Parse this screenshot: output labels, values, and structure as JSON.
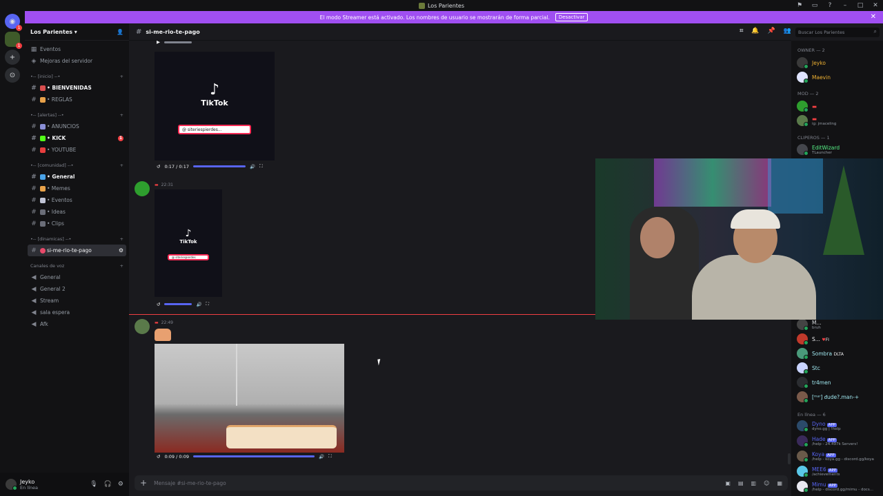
{
  "window": {
    "title": "Los Parientes"
  },
  "banner": {
    "text": "El modo Streamer está activado. Los nombres de usuario se mostrarán de forma parcial.",
    "button": "Desactivar"
  },
  "server": {
    "name": "Los Parientes"
  },
  "sidebar": {
    "top_items": [
      "Eventos",
      "Mejoras del servidor"
    ],
    "categories": [
      {
        "label": "•-- [inicio] --•",
        "channels": [
          {
            "name": "• BIENVENIDAS",
            "bright": true
          },
          {
            "name": "• REGLAS",
            "bright": false
          }
        ]
      },
      {
        "label": "•-- [alertas] --•",
        "channels": [
          {
            "name": "• ANUNCIOS",
            "bright": false
          },
          {
            "name": "• KICK",
            "bright": true,
            "badge": "1"
          },
          {
            "name": "• YOUTUBE",
            "bright": false
          }
        ]
      },
      {
        "label": "•-- [comunidad] --•",
        "channels": [
          {
            "name": "• General",
            "bright": true
          },
          {
            "name": "• Memes",
            "bright": false
          },
          {
            "name": "• Eventos",
            "bright": false
          },
          {
            "name": "• Ideas",
            "bright": false
          },
          {
            "name": "• Clips",
            "bright": false
          }
        ]
      },
      {
        "label": "•-- [dinamicas] --•",
        "channels": [
          {
            "name": "si-me-rio-te-pago",
            "active": true
          }
        ]
      }
    ],
    "voice_label": "Canales de voz",
    "voice_channels": [
      "General",
      "General 2",
      "Stream",
      "sala espera",
      "Afk"
    ]
  },
  "user_panel": {
    "name": "Jeyko",
    "status": "En línea"
  },
  "channel": {
    "name": "si-me-rio-te-pago",
    "search_placeholder": "Buscar Los Parientes",
    "input_placeholder": "Mensaje #si-me-rio-te-pago"
  },
  "messages": {
    "video1": {
      "brand": "TikTok",
      "search": "@ siteriespierdes...",
      "time": "0:17 / 0:17"
    },
    "msg2": {
      "time": "22:31",
      "brand": "TikTok",
      "search": "@ siteriespierdes"
    },
    "msg3": {
      "time": "22:49",
      "video_time": "0:09 / 0:09"
    }
  },
  "members": {
    "owner_label": "OWNER — 2",
    "owners": [
      {
        "name": "Jeyko",
        "color": "#f0b232"
      },
      {
        "name": "Maevin",
        "color": "#f0b232"
      }
    ],
    "mod_label": "MOD — 2",
    "mods": [
      {
        "name": "",
        "sub": ""
      },
      {
        "name": "",
        "sub": "ig: jmaceling"
      }
    ],
    "clipper_label": "CLIPEROS — 1",
    "clippers": [
      {
        "name": "EditWizard",
        "sub": "TLauncher"
      }
    ],
    "lower": [
      {
        "name": "M...",
        "sub": "bruh",
        "color": "#dbdee1"
      },
      {
        "name": "S...",
        "tag": "FI",
        "color": "#f2f3f5"
      },
      {
        "name": "Sombra",
        "tag": "DLTA",
        "color": "#a0e8f0"
      },
      {
        "name": "Stc",
        "color": "#a0e8f0"
      },
      {
        "name": "tr4men",
        "color": "#a0e8f0"
      },
      {
        "name": "[ᵐᵃʳ] ᵭude?.man-+",
        "color": "#a0e8f0"
      }
    ],
    "online_label": "En línea — 6",
    "bots": [
      {
        "name": "Dyno",
        "sub": "dyno.gg | !help"
      },
      {
        "name": "Hade",
        "sub": "/help - 24.497k Servers!"
      },
      {
        "name": "Koya",
        "sub": "/help - koya.gg - discord.gg/koya"
      },
      {
        "name": "MEE6",
        "sub": "/achievements"
      },
      {
        "name": "Mimu",
        "sub": "/help - discord.gg/mimu - docs..."
      }
    ],
    "app_tag": "APP"
  },
  "colors": {
    "accent": "#5865f2",
    "banner": "#a04ff2",
    "danger": "#f23f42"
  }
}
